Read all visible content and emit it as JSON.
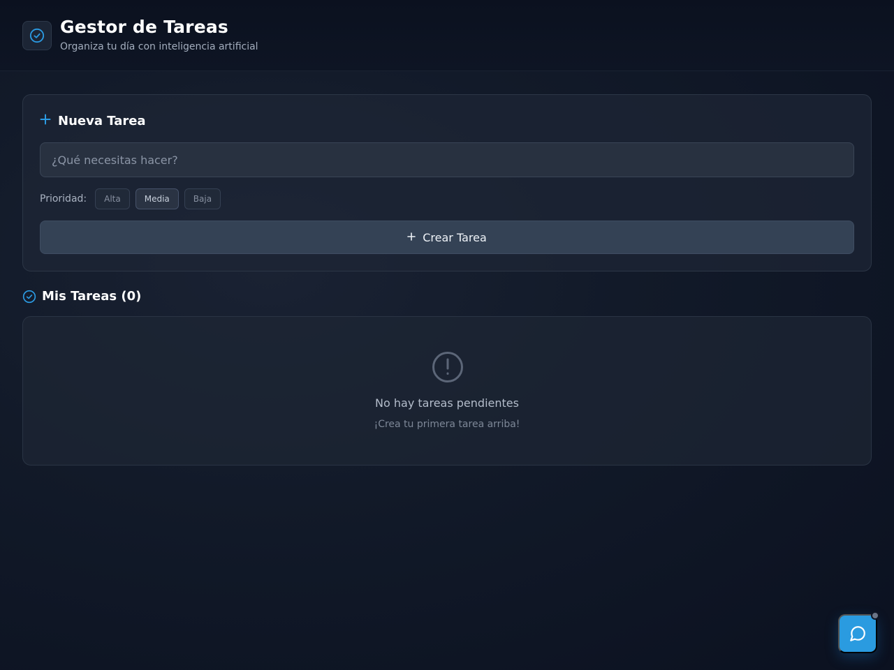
{
  "header": {
    "title": "Gestor de Tareas",
    "subtitle": "Organiza tu día con inteligencia artificial",
    "logo_icon": "check-circle-icon"
  },
  "new_task": {
    "heading": "Nueva Tarea",
    "heading_icon": "plus-icon",
    "input_placeholder": "¿Qué necesitas hacer?",
    "input_value": "",
    "priority_label": "Prioridad:",
    "priorities": [
      "Alta",
      "Media",
      "Baja"
    ],
    "selected_priority": "Media",
    "create_button_label": "Crear Tarea",
    "create_button_icon": "plus-icon"
  },
  "tasks": {
    "heading": "Mis Tareas (0)",
    "heading_icon": "check-circle-icon",
    "empty_icon": "alert-circle-icon",
    "empty_title": "No hay tareas pendientes",
    "empty_subtitle": "¡Crea tu primera tarea arriba!"
  },
  "chat": {
    "icon": "chat-bubble-icon"
  },
  "colors": {
    "accent": "#2b9be3",
    "background": "#121a29",
    "card": "#1e2635",
    "fab": "#2a9be0"
  }
}
